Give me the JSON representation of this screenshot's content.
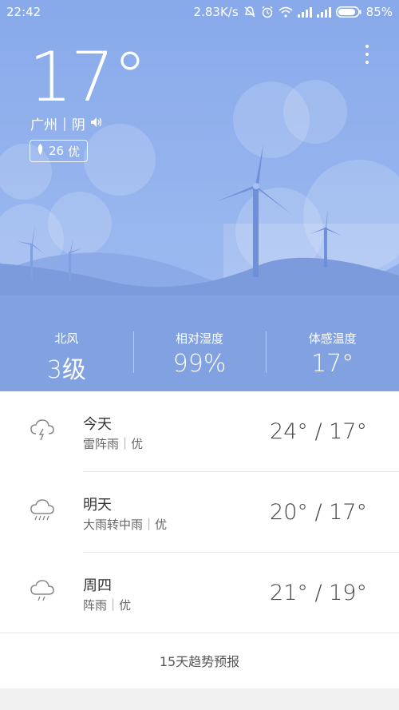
{
  "status_bar": {
    "time": "22:42",
    "network_speed": "2.83K/s",
    "battery": "85%",
    "icons": [
      "mute-icon",
      "alarm-icon",
      "wifi-icon",
      "signal-icon",
      "signal-icon",
      "battery-icon"
    ]
  },
  "current": {
    "temperature": "17°",
    "city": "广州",
    "separator": "|",
    "condition": "阴",
    "aqi_value": "26",
    "aqi_level": "优"
  },
  "stats": [
    {
      "label": "北风",
      "value": "3级"
    },
    {
      "label": "相对湿度",
      "value": "99%"
    },
    {
      "label": "体感温度",
      "value": "17°"
    }
  ],
  "forecast": [
    {
      "day": "今天",
      "condition": "雷阵雨",
      "aqi": "优",
      "temps": "24° / 17°",
      "icon": "thunderstorm-icon"
    },
    {
      "day": "明天",
      "condition": "大雨转中雨",
      "aqi": "优",
      "temps": "20° / 17°",
      "icon": "heavy-rain-icon"
    },
    {
      "day": "周四",
      "condition": "阵雨",
      "aqi": "优",
      "temps": "21° / 19°",
      "icon": "shower-icon"
    }
  ],
  "more_forecast_label": "15天趋势预报",
  "colors": {
    "sky": "#8fb0ec",
    "hill": "#7c9ddf",
    "white": "#ffffff"
  }
}
